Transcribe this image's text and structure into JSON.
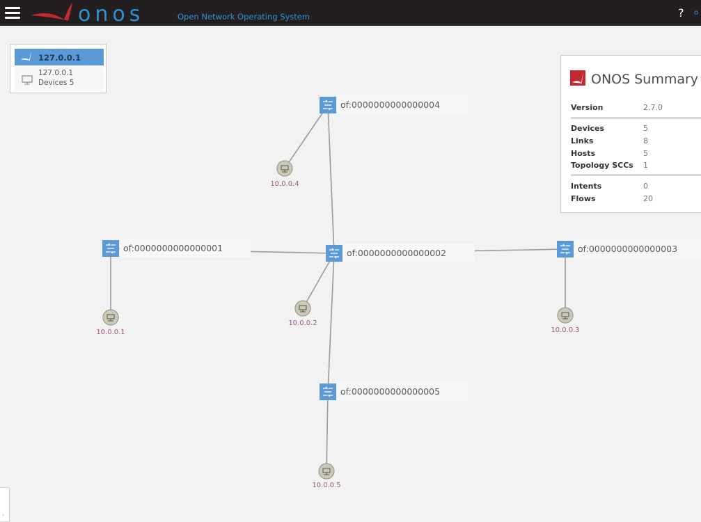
{
  "header": {
    "logo_text": "onos",
    "tagline": "Open Network Operating System",
    "help_label": "?",
    "user_label": "o"
  },
  "instance_panel": {
    "title": "127.0.0.1",
    "address": "127.0.0.1",
    "devices_text": "Devices 5"
  },
  "topology": {
    "devices": [
      {
        "id": "of:0000000000000001"
      },
      {
        "id": "of:0000000000000002"
      },
      {
        "id": "of:0000000000000003"
      },
      {
        "id": "of:0000000000000004"
      },
      {
        "id": "of:0000000000000005"
      }
    ],
    "hosts": [
      {
        "ip": "10.0.0.1"
      },
      {
        "ip": "10.0.0.2"
      },
      {
        "ip": "10.0.0.3"
      },
      {
        "ip": "10.0.0.4"
      },
      {
        "ip": "10.0.0.5"
      }
    ]
  },
  "summary": {
    "title": "ONOS Summary",
    "rows": [
      {
        "label": "Version",
        "value": "2.7.0"
      },
      {
        "label": "Devices",
        "value": "5"
      },
      {
        "label": "Links",
        "value": "8"
      },
      {
        "label": "Hosts",
        "value": "5"
      },
      {
        "label": "Topology SCCs",
        "value": "1"
      },
      {
        "label": "Intents",
        "value": "0"
      },
      {
        "label": "Flows",
        "value": "20"
      }
    ]
  },
  "colors": {
    "topbar": "#231f20",
    "accent_blue": "#2d92d4",
    "device_blue": "#5b9ad6",
    "onos_red": "#c42830",
    "host_label": "#a05a78"
  }
}
